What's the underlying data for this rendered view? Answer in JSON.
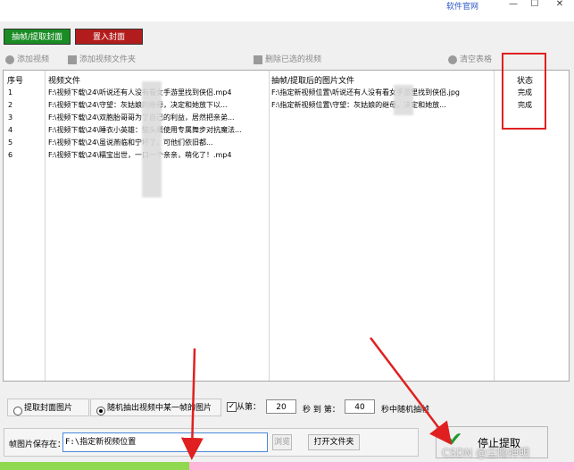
{
  "titlebar": {
    "official_link": "软件官网",
    "min_glyph": "—",
    "max_glyph": "☐",
    "close_glyph": "✕"
  },
  "top_buttons": {
    "extract": "抽帧/提取封面",
    "set_cover": "置入封面"
  },
  "toolbar": {
    "add_video": "添加视频",
    "add_folder": "添加视频文件夹",
    "remove_selected": "删除已选的视频",
    "clear_table": "清空表格"
  },
  "table": {
    "headers": {
      "index": "序号",
      "video": "视频文件",
      "image": "抽帧/提取后的图片文件",
      "status": "状态"
    },
    "rows": [
      {
        "index": "1",
        "video": "F:\\视频下载\\24\\听说还有人没有看女手游里找到侠侣.mp4",
        "image": "F:\\指定新视频位置\\听说还有人没有看女手游里找到侠侣.jpg",
        "status": "完成"
      },
      {
        "index": "2",
        "video": "F:\\视频下载\\24\\守望：灰姑娘的继母，决定和她放下以...",
        "image": "F:\\指定新视频位置\\守望：灰姑娘的继母，决定和她放...",
        "status": "完成"
      },
      {
        "index": "3",
        "video": "F:\\视频下载\\24\\双胞胎哥哥为了自己的利益，居然把亲弟...",
        "image": "",
        "status": ""
      },
      {
        "index": "4",
        "video": "F:\\视频下载\\24\\睡衣小英雄：猫头鹰使用专属舞步对抗魔法...",
        "image": "",
        "status": ""
      },
      {
        "index": "5",
        "video": "F:\\视频下载\\24\\虽说燕临和宁坏了，可他们依旧都...",
        "image": "",
        "status": ""
      },
      {
        "index": "6",
        "video": "F:\\视频下载\\24\\糯宝出世，一口一个亲亲，萌化了！.mp4",
        "image": "",
        "status": ""
      }
    ]
  },
  "options": {
    "extract_cover": "提取封面图片",
    "random_frame": "随机抽出视频中某一帧的图片",
    "from_label": "从第：",
    "from_value": "20",
    "sec_to": "秒 到 第：",
    "to_value": "40",
    "tail": "秒中随机抽帧",
    "checkbox_mark": "✓"
  },
  "save": {
    "label": "帧图片保存在：",
    "path": "F:\\指定新视频位置",
    "browse": "浏览",
    "open_folder": "打开文件夹"
  },
  "stop_button": {
    "label": "停止提取",
    "check_glyph": "✔"
  },
  "progress": {
    "fraction": 0.33
  },
  "watermark": "CSDN @尘隐神明",
  "colors": {
    "green_btn": "#1a8c24",
    "red_btn": "#b31c1c",
    "highlight": "#e02020",
    "progress_green": "#8fd84f",
    "progress_pink": "#ffb6d8"
  }
}
